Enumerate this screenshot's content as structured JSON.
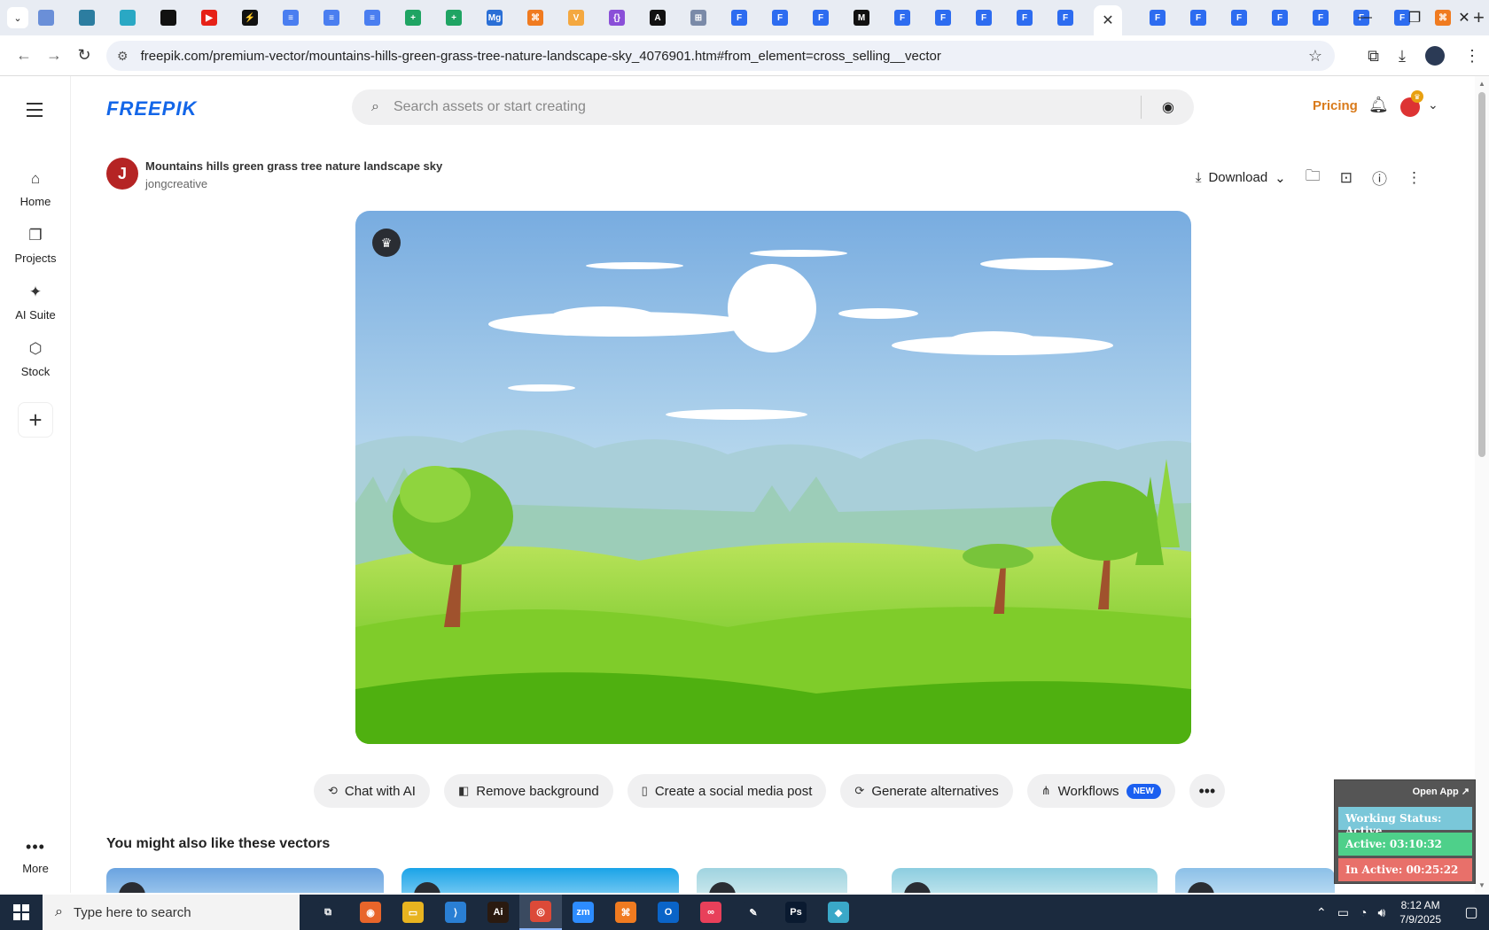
{
  "browser": {
    "tab_favicons": [
      {
        "icon": "globe-icon",
        "color": "#6a8fd8",
        "label": ""
      },
      {
        "icon": "vpn-icon",
        "color": "#2c7da0",
        "label": ""
      },
      {
        "icon": "hex-icon",
        "color": "#2aa8c4",
        "label": ""
      },
      {
        "icon": "openai-icon",
        "color": "#111111",
        "label": ""
      },
      {
        "icon": "youtube-icon",
        "color": "#e62117",
        "label": "▶"
      },
      {
        "icon": "bolt-icon",
        "color": "#111111",
        "label": "⚡"
      },
      {
        "icon": "docs-icon",
        "color": "#4a7ef0",
        "label": "≡"
      },
      {
        "icon": "docs-icon",
        "color": "#4a7ef0",
        "label": "≡"
      },
      {
        "icon": "docs-icon",
        "color": "#4a7ef0",
        "label": "≡"
      },
      {
        "icon": "sheets-icon",
        "color": "#1fa463",
        "label": "+"
      },
      {
        "icon": "sheets-icon",
        "color": "#1fa463",
        "label": "+"
      },
      {
        "icon": "mg-icon",
        "color": "#2a6fd6",
        "label": "Mg"
      },
      {
        "icon": "xampp-icon",
        "color": "#f07b20",
        "label": "⌘"
      },
      {
        "icon": "vue-icon",
        "color": "#f4a840",
        "label": "V"
      },
      {
        "icon": "code-icon",
        "color": "#8a4fd8",
        "label": "{}"
      },
      {
        "icon": "a-icon",
        "color": "#111111",
        "label": "A"
      },
      {
        "icon": "grid-icon",
        "color": "#7a8aa8",
        "label": "⊞"
      },
      {
        "icon": "forms-icon",
        "color": "#2d6cf0",
        "label": "F"
      },
      {
        "icon": "forms-icon",
        "color": "#2d6cf0",
        "label": "F"
      },
      {
        "icon": "forms-icon",
        "color": "#2d6cf0",
        "label": "F"
      },
      {
        "icon": "m-icon",
        "color": "#111111",
        "label": "M"
      },
      {
        "icon": "forms-icon",
        "color": "#2d6cf0",
        "label": "F"
      },
      {
        "icon": "forms-icon",
        "color": "#2d6cf0",
        "label": "F"
      },
      {
        "icon": "forms-icon",
        "color": "#2d6cf0",
        "label": "F"
      },
      {
        "icon": "forms-icon",
        "color": "#2d6cf0",
        "label": "F"
      },
      {
        "icon": "forms-icon",
        "color": "#2d6cf0",
        "label": "F"
      }
    ],
    "tab_favicons_after": [
      {
        "icon": "forms-icon",
        "color": "#2d6cf0",
        "label": "F"
      },
      {
        "icon": "forms-icon",
        "color": "#2d6cf0",
        "label": "F"
      },
      {
        "icon": "forms-icon",
        "color": "#2d6cf0",
        "label": "F"
      },
      {
        "icon": "forms-icon",
        "color": "#2d6cf0",
        "label": "F"
      },
      {
        "icon": "forms-icon",
        "color": "#2d6cf0",
        "label": "F"
      },
      {
        "icon": "forms-icon",
        "color": "#2d6cf0",
        "label": "F"
      },
      {
        "icon": "forms-icon",
        "color": "#2d6cf0",
        "label": "F"
      },
      {
        "icon": "xampp-icon",
        "color": "#f07b20",
        "label": "⌘"
      }
    ],
    "url": "freepik.com/premium-vector/mountains-hills-green-grass-tree-nature-landscape-sky_4076901.htm#from_element=cross_selling__vector"
  },
  "header": {
    "logo": "FREEPIK",
    "search_placeholder": "Search assets or start creating",
    "pricing": "Pricing"
  },
  "sidebar": {
    "items": [
      {
        "icon": "home-icon",
        "glyph": "⌂",
        "label": "Home"
      },
      {
        "icon": "projects-icon",
        "glyph": "❐",
        "label": "Projects"
      },
      {
        "icon": "sparkle-icon",
        "glyph": "✦",
        "label": "AI Suite"
      },
      {
        "icon": "stock-icon",
        "glyph": "⬡",
        "label": "Stock"
      }
    ],
    "more_label": "More"
  },
  "asset": {
    "avatar_letter": "J",
    "title": "Mountains hills green grass tree nature landscape sky",
    "author": "jongcreative",
    "download_label": "Download"
  },
  "tools": [
    {
      "icon": "chat-icon",
      "glyph": "💬",
      "label": "Chat with AI"
    },
    {
      "icon": "remove-bg-icon",
      "glyph": "◧",
      "label": "Remove background"
    },
    {
      "icon": "phone-icon",
      "glyph": "▯",
      "label": "Create a social media post"
    },
    {
      "icon": "refresh-icon",
      "glyph": "⟳",
      "label": "Generate alternatives"
    },
    {
      "icon": "workflow-icon",
      "glyph": "⋔",
      "label": "Workflows",
      "badge": "NEW"
    }
  ],
  "related": {
    "title": "You might also like these vectors"
  },
  "tracker": {
    "open_app": "Open App ↗",
    "status": "Working Status: Active",
    "active": "Active: 03:10:32",
    "inactive": "In Active: 00:25:22"
  },
  "taskbar": {
    "search_text": "Type here to search",
    "time": "8:12 AM",
    "date": "7/9/2025",
    "apps": [
      {
        "icon": "task-view-icon",
        "color": "#1b2a3e",
        "label": "⧉"
      },
      {
        "icon": "firefox-icon",
        "color": "#e8652a",
        "label": "◉"
      },
      {
        "icon": "file-explorer-icon",
        "color": "#e8b420",
        "label": "▭"
      },
      {
        "icon": "vscode-icon",
        "color": "#2a7fd4",
        "label": "⟩"
      },
      {
        "icon": "illustrator-icon",
        "color": "#2a1a10",
        "label": "Ai"
      },
      {
        "icon": "chrome-icon",
        "color": "#dc4a38",
        "label": "◎"
      },
      {
        "icon": "zoom-icon",
        "color": "#2d8cff",
        "label": "zm"
      },
      {
        "icon": "xampp-icon",
        "color": "#f07b20",
        "label": "⌘"
      },
      {
        "icon": "outlook-icon",
        "color": "#0a64c8",
        "label": "O"
      },
      {
        "icon": "creative-cloud-icon",
        "color": "#e8405a",
        "label": "∞"
      },
      {
        "icon": "pen-tool-icon",
        "color": "#1b2a3e",
        "label": "✎"
      },
      {
        "icon": "photoshop-icon",
        "color": "#0a1a30",
        "label": "Ps"
      },
      {
        "icon": "app-icon",
        "color": "#3aa8c8",
        "label": "◆"
      }
    ]
  }
}
